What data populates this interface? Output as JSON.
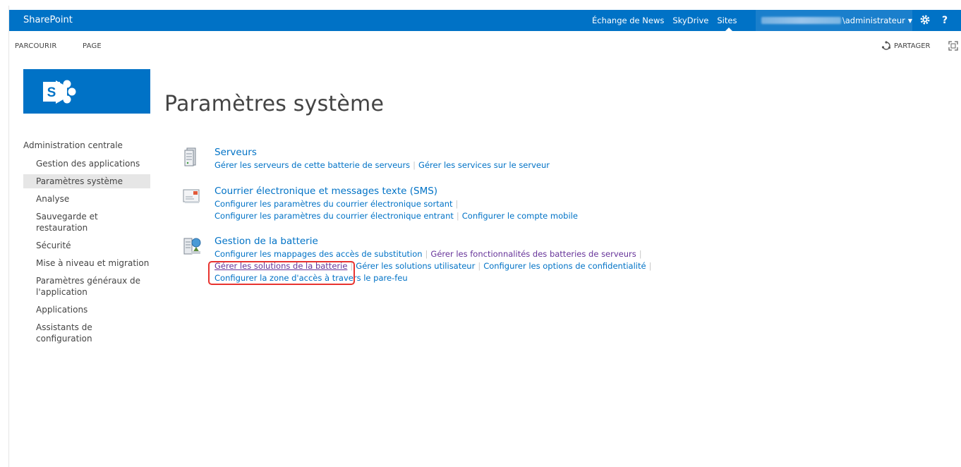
{
  "suitebar": {
    "brand": "SharePoint",
    "links": [
      "Échange de News",
      "SkyDrive",
      "Sites"
    ],
    "user": "\\administrateur",
    "help": "?"
  },
  "ribbon": {
    "tabs": [
      "PARCOURIR",
      "PAGE"
    ],
    "share_label": "PARTAGER"
  },
  "page": {
    "title": "Paramètres système"
  },
  "nav": {
    "header": "Administration centrale",
    "items": [
      "Gestion des applications",
      "Paramètres système",
      "Analyse",
      "Sauvegarde et restauration",
      "Sécurité",
      "Mise à niveau et migration",
      "Paramètres généraux de l'application",
      "Applications",
      "Assistants de configuration"
    ],
    "selected_index": 1
  },
  "sections": {
    "servers": {
      "title": "Serveurs",
      "links": [
        "Gérer les serveurs de cette batterie de serveurs",
        "Gérer les services sur le serveur"
      ]
    },
    "email": {
      "title": "Courrier électronique et messages texte (SMS)",
      "links": [
        "Configurer les paramètres du courrier électronique sortant",
        "Configurer les paramètres du courrier électronique entrant",
        "Configurer le compte mobile"
      ]
    },
    "farm": {
      "title": "Gestion de la batterie",
      "links": [
        "Configurer les mappages des accès de substitution",
        "Gérer les fonctionnalités des batteries de serveurs",
        "Gérer les solutions de la batterie",
        "Gérer les solutions utilisateur",
        "Configurer les options de confidentialité",
        "Configurer la zone d'accès à travers le pare-feu"
      ]
    }
  },
  "colors": {
    "suitebar": "#0072c6",
    "link": "#0072c6",
    "visited": "#663399",
    "highlight": "#e8332f"
  }
}
